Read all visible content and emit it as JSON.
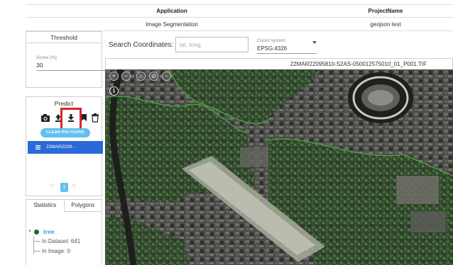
{
  "info_table": {
    "headers": {
      "application": "Application",
      "project_name": "ProjectName"
    },
    "row": {
      "application": "Image Segmentation",
      "project_name": "geojson test"
    }
  },
  "threshold": {
    "title": "Threshold",
    "score_label": "Score (%)",
    "score_value": "30"
  },
  "predict": {
    "title": "Predict",
    "tools": [
      "camera-icon",
      "upload-icon",
      "download-icon",
      "bookmark-icon",
      "trash-icon"
    ],
    "clear_label": "CLEAR POLYGONS",
    "file_item": "22MAR2209···",
    "pagination": {
      "prev": "|<",
      "page": "1",
      "next": ">|"
    }
  },
  "stats": {
    "tabs": [
      "Statistics",
      "Polygons"
    ],
    "class_name": "tree",
    "in_dataset": "In Dataset: 641",
    "in_image": "In Image: 0"
  },
  "search": {
    "label": "Search Coordinates:",
    "placeholder": "lat, long",
    "coord_system_label": "Coord system",
    "coord_system_value": "EPSG:4326"
  },
  "map": {
    "filename": "22MAR22095810-S2AS-050012575010_01_P001.TIF",
    "controls": [
      "+",
      "−",
      "⌂",
      "⊘",
      "−"
    ],
    "info": "i"
  },
  "colors": {
    "accent": "#62c1ec",
    "selected": "#2a6ad6",
    "highlight": "#d9262e",
    "vegetation": "#3c7a35"
  }
}
